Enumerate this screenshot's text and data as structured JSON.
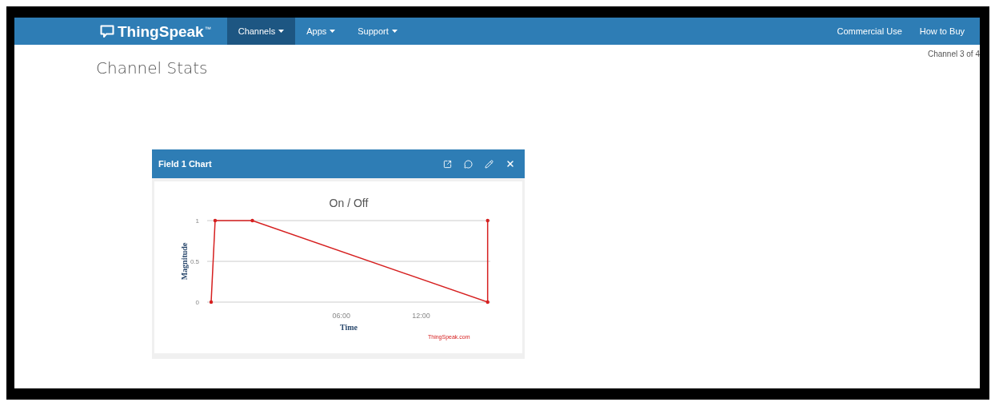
{
  "navbar": {
    "logo": {
      "text": "ThingSpeak",
      "mark": "™"
    },
    "menus": [
      {
        "label": "Channels",
        "selected": true,
        "dropdown": true
      },
      {
        "label": "Apps",
        "selected": false,
        "dropdown": true
      },
      {
        "label": "Support",
        "selected": false,
        "dropdown": true
      }
    ],
    "links": [
      "Commercial Use",
      "How to Buy"
    ]
  },
  "channel_counter": "Channel 3 of 4",
  "page_title": "Channel Stats",
  "chart_card": {
    "title": "Field 1 Chart",
    "chart_data": {
      "type": "line",
      "title": "On / Off",
      "xlabel": "Time",
      "ylabel": "Magnitude",
      "x": [
        -3.8,
        -3.5,
        -0.7,
        17,
        17
      ],
      "series": [
        {
          "color": "#d62020",
          "values": [
            0,
            1,
            1,
            0,
            1
          ]
        }
      ],
      "xlim": [
        -4.1,
        17.2
      ],
      "ylim": [
        0,
        1
      ],
      "xticks": [
        {
          "value": 6,
          "label": "06:00"
        },
        {
          "value": 12,
          "label": "12:00"
        }
      ],
      "yticks": [
        0,
        0.5,
        1
      ]
    },
    "credit": "ThingSpeak.com"
  }
}
